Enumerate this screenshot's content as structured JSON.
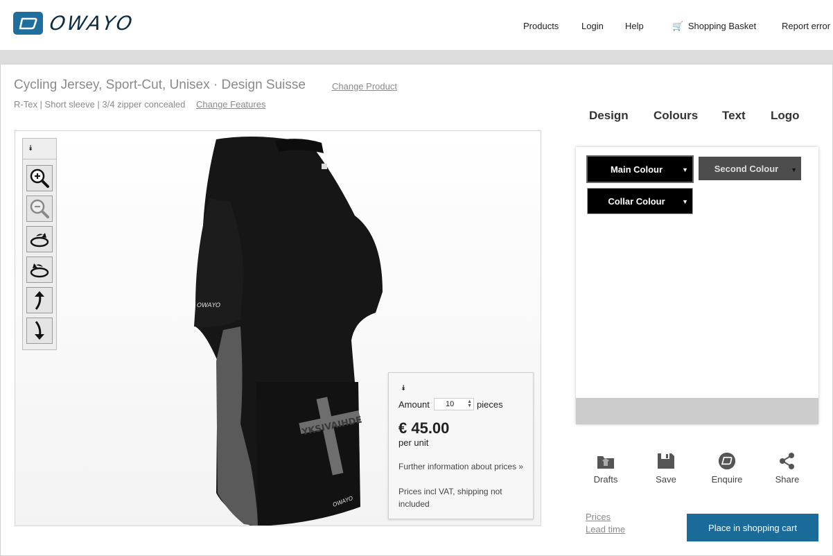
{
  "header": {
    "brand": "OWAYO",
    "nav": {
      "products": "Products",
      "login": "Login",
      "help": "Help",
      "basket": "Shopping Basket",
      "report": "Report error"
    }
  },
  "product": {
    "title": "Cycling Jersey, Sport-Cut, Unisex · Design Suisse",
    "change_product": "Change Product",
    "features": "R-Tex | Short sleeve | 3/4 zipper concealed",
    "change_features": "Change Features"
  },
  "viewer": {
    "jersey_text": "YKSIVAIHDE",
    "toolbar_toggle": "expand-toggle-icon",
    "tools": [
      "zoom-in-icon",
      "zoom-out-icon",
      "rotate-right-icon",
      "rotate-left-icon",
      "tilt-up-icon",
      "tilt-down-icon"
    ]
  },
  "pricing": {
    "amount_label": "Amount",
    "amount_value": "10",
    "pieces_label": "pieces",
    "price": "€ 45.00",
    "per_unit": "per unit",
    "further_info": "Further information about prices »",
    "vat_note": "Prices incl VAT, shipping not included"
  },
  "tabs": {
    "design": "Design",
    "colours": "Colours",
    "text": "Text",
    "logo": "Logo"
  },
  "colours": {
    "main": {
      "label": "Main Colour",
      "color": "#000000"
    },
    "second": {
      "label": "Second Colour",
      "color": "#4d4d4d"
    },
    "collar": {
      "label": "Collar Colour",
      "color": "#000000"
    }
  },
  "actions": {
    "drafts": "Drafts",
    "save": "Save",
    "enquire": "Enquire",
    "share": "Share"
  },
  "footer_links": {
    "prices": "Prices",
    "lead_time": "Lead time"
  },
  "cart_button": "Place in shopping cart",
  "accent_color": "#1b6b9a"
}
